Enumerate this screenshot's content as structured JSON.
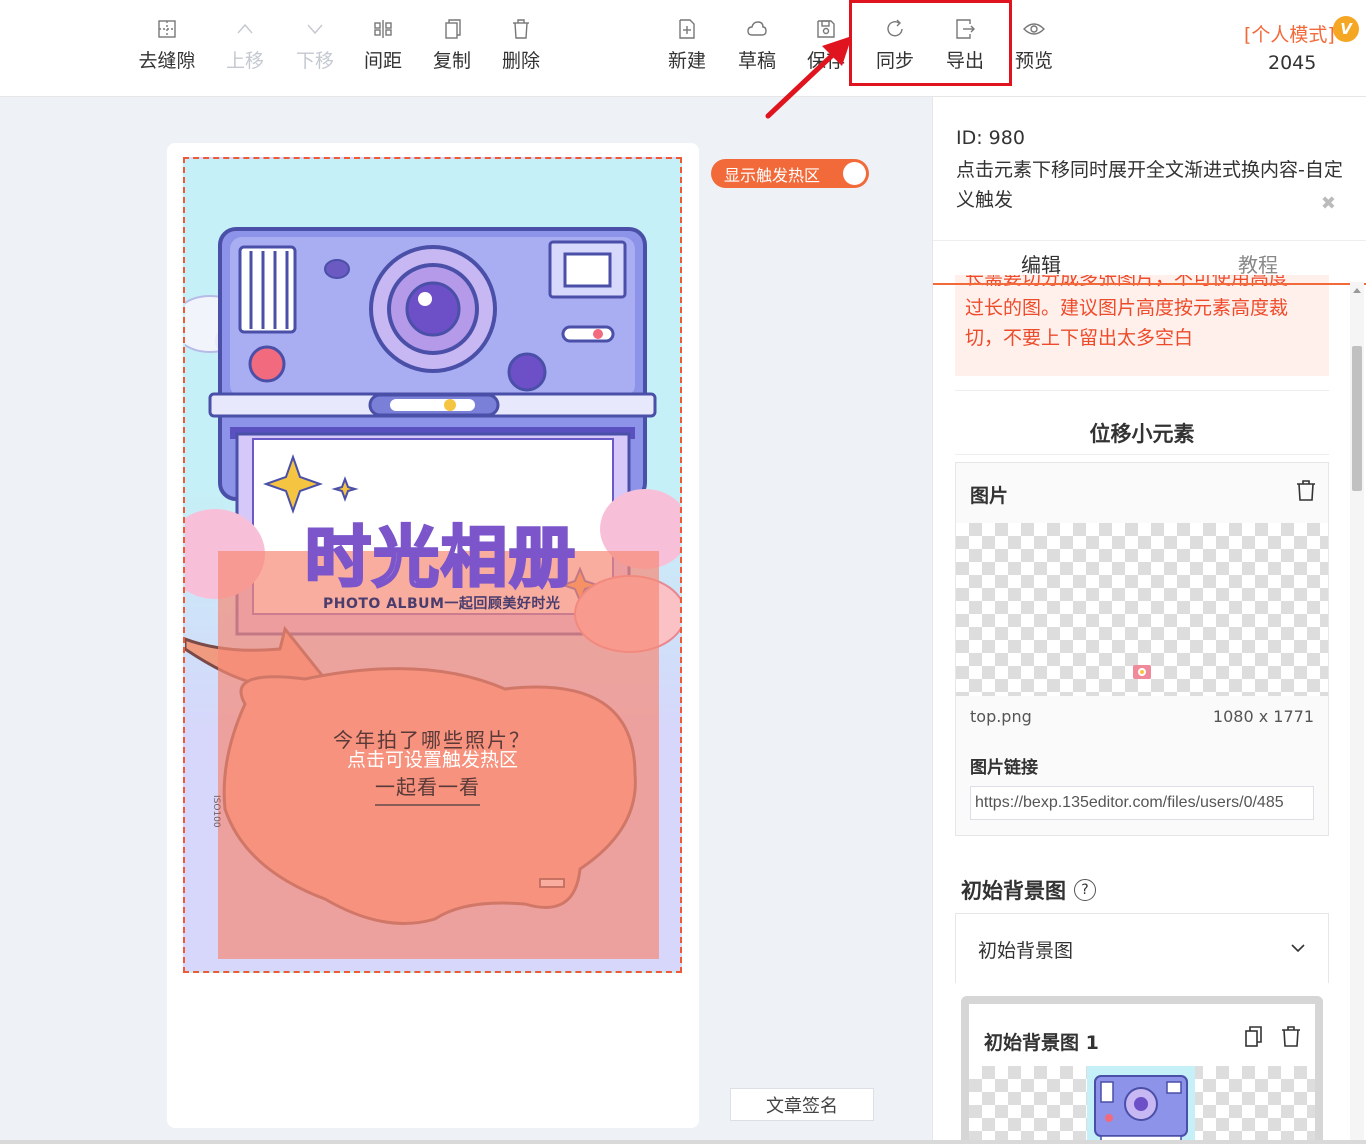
{
  "toolbar": {
    "left_buttons": [
      {
        "label": "去缝隙",
        "icon": "grid-icon",
        "enabled": true
      },
      {
        "label": "上移",
        "icon": "chevron-up-icon",
        "enabled": false
      },
      {
        "label": "下移",
        "icon": "chevron-down-icon",
        "enabled": false
      },
      {
        "label": "间距",
        "icon": "spacing-icon",
        "enabled": true
      },
      {
        "label": "复制",
        "icon": "copy-icon",
        "enabled": true
      },
      {
        "label": "删除",
        "icon": "trash-icon",
        "enabled": true
      }
    ],
    "right_buttons": [
      {
        "label": "新建",
        "icon": "new-file-icon"
      },
      {
        "label": "草稿",
        "icon": "cloud-icon"
      },
      {
        "label": "保存",
        "icon": "save-icon"
      },
      {
        "label": "同步",
        "icon": "sync-icon"
      },
      {
        "label": "导出",
        "icon": "export-icon"
      },
      {
        "label": "预览",
        "icon": "eye-icon"
      }
    ],
    "mode_label": "[个人模式]",
    "vip_badge": "V",
    "user_number": "2045",
    "annotation_color": "#e0141e"
  },
  "canvas": {
    "title_art": "时光相册",
    "subtitle_art": "PHOTO ALBUM一起回顾美好时光",
    "bubble_question": "今年拍了哪些照片？",
    "hotzone_hint": "点击可设置触发热区",
    "bubble_action": "一起看一看",
    "iso_label": "ISO100",
    "toggle_label": "显示触发热区",
    "signature_button": "文章签名"
  },
  "panel": {
    "id_text": "ID: 980",
    "description": "点击元素下移同时展开全文渐进式换内容-自定义触发",
    "tabs": {
      "edit": "编辑",
      "tutorial": "教程"
    },
    "warning_lines": [
      "长需要切分成多张图片，不可使用高度",
      "过长的图。建议图片高度按元素高度裁",
      "切，不要上下留出太多空白"
    ],
    "section_title": "位移小元素",
    "image_card": {
      "title": "图片",
      "file_name": "top.png",
      "file_size": "1080 x 1771",
      "link_label": "图片链接",
      "link_value": "https://bexp.135editor.com/files/users/0/485"
    },
    "bg_section": {
      "title": "初始背景图",
      "help": "?",
      "collapse_label": "初始背景图",
      "card_title": "初始背景图 1"
    }
  },
  "colors": {
    "accent": "#f26a3a",
    "warning_text": "#ee4b2b"
  }
}
